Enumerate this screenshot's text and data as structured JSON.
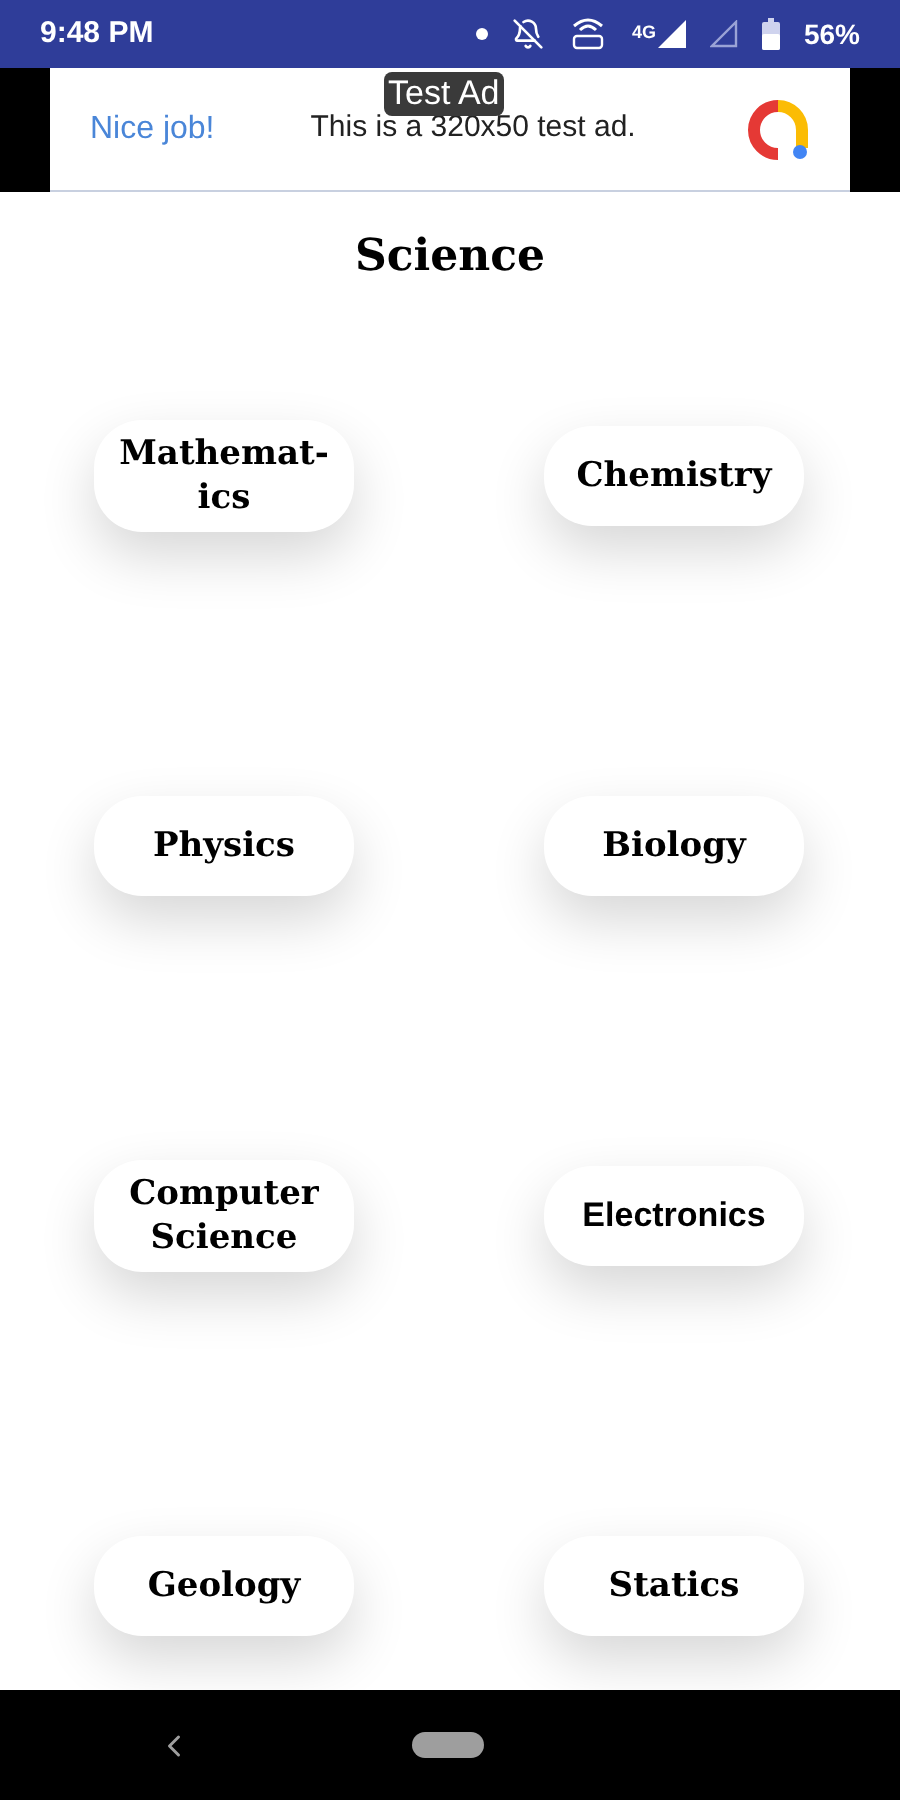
{
  "status_bar": {
    "time": "9:48 PM",
    "network": "4G",
    "battery": "56%"
  },
  "ad": {
    "label": "Test Ad",
    "headline": "Nice job!",
    "text": "This is a 320x50 test ad."
  },
  "title": "Science",
  "subjects": [
    {
      "label": "Mathemat-ics",
      "kind": "serif"
    },
    {
      "label": "Chemistry",
      "kind": "serif"
    },
    {
      "label": "Physics",
      "kind": "serif"
    },
    {
      "label": "Biology",
      "kind": "serif"
    },
    {
      "label": "Computer Science",
      "kind": "serif"
    },
    {
      "label": "Electronics",
      "kind": "sans"
    },
    {
      "label": "Geology",
      "kind": "serif"
    },
    {
      "label": "Statics",
      "kind": "serif"
    }
  ]
}
